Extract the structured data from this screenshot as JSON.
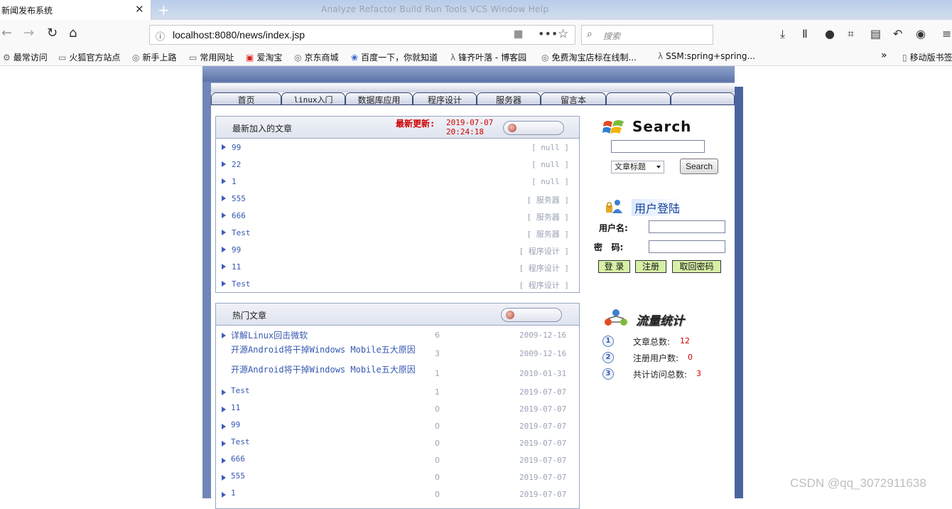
{
  "browser": {
    "tab_title": "新闻发布系统",
    "close_glyph": "✕",
    "newtab_glyph": "+",
    "ghost_menu": "Analyze  Refactor  Build  Run  Tools  VCS  Window  Help",
    "url": "localhost:8080/news/index.jsp",
    "search_placeholder": "搜索",
    "bookmarks": [
      {
        "icon": "gear-icon",
        "label": "最常访问"
      },
      {
        "icon": "folder-icon",
        "label": "火狐官方站点"
      },
      {
        "icon": "globe-icon",
        "label": "新手上路"
      },
      {
        "icon": "folder-icon",
        "label": "常用网址"
      },
      {
        "icon": "taobao-icon",
        "label": "爱淘宝"
      },
      {
        "icon": "globe-icon",
        "label": "京东商城"
      },
      {
        "icon": "baidu-icon",
        "label": "百度一下，你就知道"
      },
      {
        "icon": "blog-icon",
        "label": "锋齐叶落 - 博客园"
      },
      {
        "icon": "globe-icon",
        "label": "免费淘宝店标在线制..."
      },
      {
        "icon": "blog-icon",
        "label": "SSM:spring+spring..."
      }
    ],
    "mobile_bookmarks": "移动版书签"
  },
  "site": {
    "nav": [
      "首页",
      "linux入门",
      "数据库应用",
      "程序设计",
      "服务器",
      "留言本",
      "",
      ""
    ],
    "latest": {
      "title": "最新加入的文章",
      "update_label": "最新更新:",
      "update_time": "2019-07-07 20:24:18",
      "items": [
        {
          "name": "99",
          "cat": "[ null ]"
        },
        {
          "name": "22",
          "cat": "[ null ]"
        },
        {
          "name": "1",
          "cat": "[ null ]"
        },
        {
          "name": "555",
          "cat": "[ 服务器 ]"
        },
        {
          "name": "666",
          "cat": "[ 服务器 ]"
        },
        {
          "name": "Test",
          "cat": "[ 服务器 ]"
        },
        {
          "name": "99",
          "cat": "[ 程序设计 ]"
        },
        {
          "name": "11",
          "cat": "[ 程序设计 ]"
        },
        {
          "name": "Test",
          "cat": "[ 程序设计 ]"
        }
      ]
    },
    "hot": {
      "title": "热门文章",
      "items": [
        {
          "name": "详解Linux回击微软",
          "count": "6",
          "date": "2009-12-16"
        },
        {
          "name": "开源Android将干掉Windows Mobile五大原因",
          "count": "3",
          "date": "2009-12-16"
        },
        {
          "name": "开源Android将干掉Windows Mobile五大原因",
          "count": "1",
          "date": "2010-01-31"
        },
        {
          "name": "Test",
          "count": "1",
          "date": "2019-07-07"
        },
        {
          "name": "11",
          "count": "0",
          "date": "2019-07-07"
        },
        {
          "name": "99",
          "count": "0",
          "date": "2019-07-07"
        },
        {
          "name": "Test",
          "count": "0",
          "date": "2019-07-07"
        },
        {
          "name": "666",
          "count": "0",
          "date": "2019-07-07"
        },
        {
          "name": "555",
          "count": "0",
          "date": "2019-07-07"
        },
        {
          "name": "1",
          "count": "0",
          "date": "2019-07-07"
        }
      ]
    },
    "search": {
      "heading": "Search",
      "input_value": "",
      "select_value": "文章标题",
      "button": "Search"
    },
    "login": {
      "heading": "用户登陆",
      "username_label": "用户名:",
      "password_label": "密   码:",
      "login_btn": "登 录",
      "register_btn": "注册",
      "recover_btn": "取回密码"
    },
    "stats": {
      "heading": "流量统计",
      "items": [
        {
          "num": "1",
          "label": "文章总数:",
          "value": "12"
        },
        {
          "num": "2",
          "label": "注册用户数:",
          "value": "0"
        },
        {
          "num": "3",
          "label": "共计访问总数:",
          "value": "3"
        }
      ]
    }
  },
  "watermark": "CSDN @qq_3072911638"
}
